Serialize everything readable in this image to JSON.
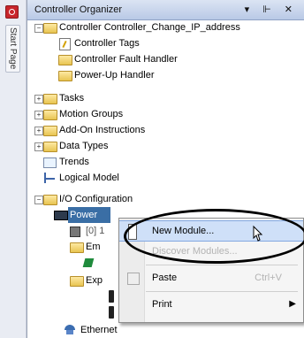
{
  "side": {
    "start_tab": "Start Page"
  },
  "organizer": {
    "title": "Controller Organizer",
    "controls": "▾ ⊩ ✕",
    "tree": [
      {
        "id": "controller",
        "label": "Controller Controller_Change_IP_address",
        "level": 1,
        "expander": "−",
        "icon": "folder-icon"
      },
      {
        "id": "controller-tags",
        "label": "Controller Tags",
        "level": 2,
        "icon": "tag-icon"
      },
      {
        "id": "fault-handler",
        "label": "Controller Fault Handler",
        "level": 2,
        "icon": "folder-icon"
      },
      {
        "id": "powerup-handler",
        "label": "Power-Up Handler",
        "level": 2,
        "icon": "folder-icon"
      },
      {
        "id": "tasks",
        "label": "Tasks",
        "level": 1,
        "expander": "+",
        "icon": "folder-icon"
      },
      {
        "id": "motion-groups",
        "label": "Motion Groups",
        "level": 1,
        "expander": "+",
        "icon": "folder-icon"
      },
      {
        "id": "addon-instructions",
        "label": "Add-On Instructions",
        "level": 1,
        "expander": "+",
        "icon": "folder-icon"
      },
      {
        "id": "data-types",
        "label": "Data Types",
        "level": 1,
        "expander": "+",
        "icon": "folder-icon"
      },
      {
        "id": "trends",
        "label": "Trends",
        "level": 1,
        "icon": "trend-icon"
      },
      {
        "id": "logical-model",
        "label": "Logical Model",
        "level": 1,
        "icon": "logical-icon"
      },
      {
        "id": "io-config",
        "label": "I/O Configuration",
        "level": 1,
        "expander": "−",
        "icon": "folder-icon"
      },
      {
        "id": "power",
        "label": "Power",
        "level": 2,
        "icon": "power-icon"
      },
      {
        "id": "module-a",
        "label": "[0] 1",
        "level": 3,
        "icon": "module-icon"
      },
      {
        "id": "em",
        "label": "Em",
        "level": 3,
        "icon": "folder-icon"
      },
      {
        "id": "green-module",
        "label": "",
        "level": 4,
        "icon": "green-icon"
      },
      {
        "id": "exp",
        "label": "Exp",
        "level": 3,
        "icon": "folder-icon"
      },
      {
        "id": "module-b",
        "label": "",
        "level": 4,
        "icon": "page-icon"
      },
      {
        "id": "module-c",
        "label": "",
        "level": 4,
        "icon": "page-icon"
      },
      {
        "id": "ethernet",
        "label": "Ethernet",
        "level": 2,
        "icon": "network-icon"
      }
    ]
  },
  "context_menu": {
    "items": [
      {
        "label": "New Module...",
        "state": "hover"
      },
      {
        "label": "Discover Modules...",
        "state": "disabled"
      },
      {
        "label": "Paste",
        "shortcut": "Ctrl+V",
        "state": "normal"
      },
      {
        "label": "Print",
        "submenu": "▶",
        "state": "normal"
      }
    ]
  }
}
